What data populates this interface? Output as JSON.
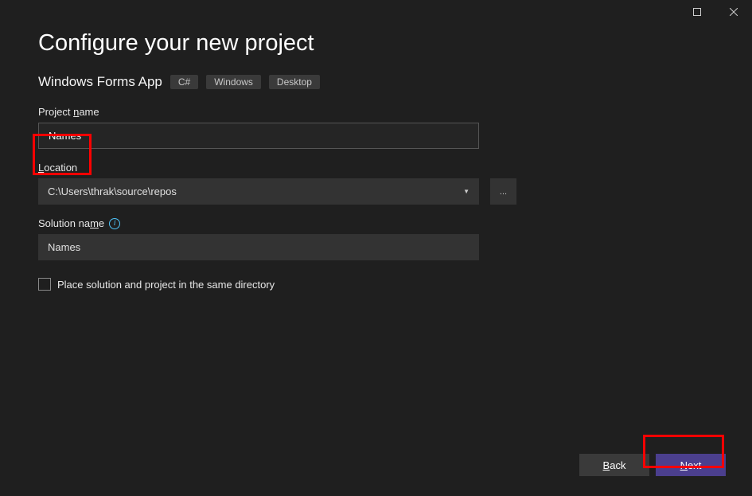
{
  "title": "Configure your new project",
  "template": {
    "name": "Windows Forms App",
    "tags": [
      "C#",
      "Windows",
      "Desktop"
    ]
  },
  "fields": {
    "projectName": {
      "label": "Project name",
      "label_underline": "n",
      "value": "Names"
    },
    "location": {
      "label": "Location",
      "label_underline": "L",
      "value": "C:\\Users\\thrak\\source\\repos",
      "browse": "..."
    },
    "solutionName": {
      "label": "Solution name",
      "label_underline": "m",
      "value": "Names"
    },
    "placeSolution": {
      "label": "Place solution and project in the same directory",
      "label_underline": "d",
      "checked": false
    }
  },
  "footer": {
    "back": "Back",
    "back_underline": "B",
    "next": "Next",
    "next_underline": "N"
  }
}
